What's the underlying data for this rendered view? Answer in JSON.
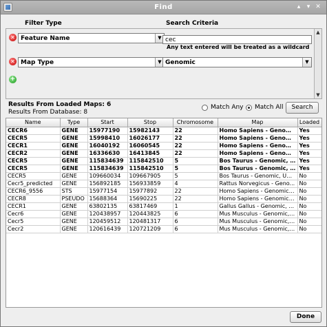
{
  "window": {
    "title": "Find"
  },
  "filter": {
    "filter_type_label": "Filter Type",
    "search_criteria_label": "Search Criteria",
    "rows": [
      {
        "type": "Feature Name",
        "criteria": "cec",
        "hint": "Any text entered will be treated as a wildcard"
      },
      {
        "type": "Map Type",
        "criteria": "Genomic"
      }
    ]
  },
  "results": {
    "loaded_label": "Results From Loaded Maps: 6",
    "database_label": "Results From Database:  8",
    "match_any": "Match Any",
    "match_all": "Match All",
    "selected_match": "all",
    "search_button": "Search"
  },
  "table": {
    "columns": [
      "Name",
      "Type",
      "Start",
      "Stop",
      "Chromosome",
      "Map",
      "Loaded"
    ],
    "rows": [
      {
        "bold": true,
        "cells": [
          "CECR6",
          "GENE",
          "15977190",
          "15982143",
          "22",
          "Homo Sapiens - Genomic, ...",
          "Yes"
        ]
      },
      {
        "bold": true,
        "cells": [
          "CECR5",
          "GENE",
          "15998410",
          "16026177",
          "22",
          "Homo Sapiens - Genomic, ...",
          "Yes"
        ]
      },
      {
        "bold": true,
        "cells": [
          "CECR1",
          "GENE",
          "16040192",
          "16060545",
          "22",
          "Homo Sapiens - Genomic, ...",
          "Yes"
        ]
      },
      {
        "bold": true,
        "cells": [
          "CECR2",
          "GENE",
          "16336630",
          "16413845",
          "22",
          "Homo Sapiens - Genomic, ...",
          "Yes"
        ]
      },
      {
        "bold": true,
        "cells": [
          "CECR5",
          "GENE",
          "115834639",
          "115842510",
          "5",
          "Bos Taurus - Genomic, N...",
          "Yes"
        ]
      },
      {
        "bold": true,
        "cells": [
          "CECR5",
          "GENE",
          "115834639",
          "115842510",
          "5",
          "Bos Taurus - Genomic, N...",
          "Yes"
        ]
      },
      {
        "bold": false,
        "cells": [
          "CECR5",
          "GENE",
          "109660034",
          "109667905",
          "5",
          "Bos Taurus - Genomic, UM...",
          "No"
        ]
      },
      {
        "bold": false,
        "cells": [
          "Cecr5_predicted",
          "GENE",
          "156892185",
          "156933859",
          "4",
          "Rattus Norvegicus - Geno...",
          "No"
        ]
      },
      {
        "bold": false,
        "cells": [
          "CECR6_9556",
          "STS",
          "15977154",
          "15977892",
          "22",
          "Homo Sapiens - Genomic, ...",
          "No"
        ]
      },
      {
        "bold": false,
        "cells": [
          "CECR8",
          "PSEUDO",
          "15688364",
          "15690225",
          "22",
          "Homo Sapiens - Genomic, ...",
          "No"
        ]
      },
      {
        "bold": false,
        "cells": [
          "CECR1",
          "GENE",
          "63802135",
          "63817469",
          "1",
          "Gallus Gallus - Genomic, N...",
          "No"
        ]
      },
      {
        "bold": false,
        "cells": [
          "Cecr6",
          "GENE",
          "120438957",
          "120443825",
          "6",
          "Mus Musculus - Genomic, ...",
          "No"
        ]
      },
      {
        "bold": false,
        "cells": [
          "Cecr5",
          "GENE",
          "120459512",
          "120481317",
          "6",
          "Mus Musculus - Genomic, ...",
          "No"
        ]
      },
      {
        "bold": false,
        "cells": [
          "Cecr2",
          "GENE",
          "120616439",
          "120721209",
          "6",
          "Mus Musculus - Genomic, ...",
          "No"
        ]
      }
    ]
  },
  "footer": {
    "done_button": "Done"
  }
}
